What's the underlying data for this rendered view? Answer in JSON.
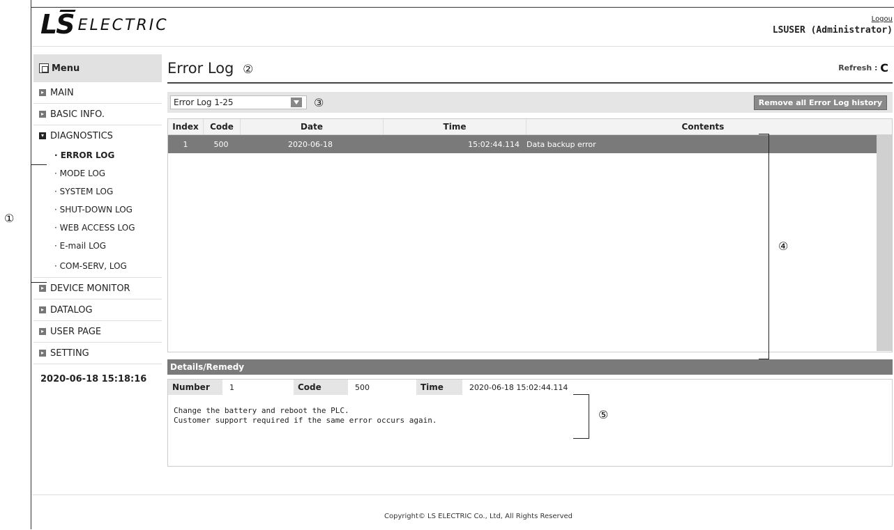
{
  "header": {
    "logo_ls": "LS",
    "logo_electric": "ELECTRIC",
    "logout": "Logou",
    "user": "LSUSER (Administrator)"
  },
  "sidebar": {
    "menu_title": "Menu",
    "items": [
      {
        "label": "MAIN"
      },
      {
        "label": "BASIC INFO."
      },
      {
        "label": "DIAGNOSTICS"
      }
    ],
    "sub_items": [
      "· ERROR LOG",
      "· MODE LOG",
      "· SYSTEM LOG",
      "· SHUT-DOWN LOG",
      "· WEB ACCESS LOG",
      "· E-mail LOG",
      "· COM-SERV, LOG"
    ],
    "items_after": [
      {
        "label": "DEVICE MONITOR"
      },
      {
        "label": "DATALOG"
      },
      {
        "label": "USER PAGE"
      },
      {
        "label": "SETTING"
      }
    ],
    "datetime": "2020-06-18 15:18:16"
  },
  "annotations": {
    "c1": "①",
    "c2": "②",
    "c3": "③",
    "c4": "④",
    "c5": "⑤"
  },
  "main": {
    "title": "Error Log",
    "refresh_label": "Refresh :",
    "refresh_icon": "C",
    "select_value": "Error Log 1-25",
    "remove_button": "Remove all Error Log history",
    "columns": [
      "Index",
      "Code",
      "Date",
      "Time",
      "Contents"
    ],
    "rows": [
      {
        "index": "1",
        "code": "500",
        "date": "2020-06-18",
        "time": "15:02:44.114",
        "contents": "Data backup error"
      }
    ],
    "details_title": "Details/Remedy",
    "details": {
      "number_label": "Number",
      "number_value": "1",
      "code_label": "Code",
      "code_value": "500",
      "time_label": "Time",
      "time_value": "2020-06-18 15:02:44.114",
      "remedy_line1": "Change the battery and reboot the PLC.",
      "remedy_line2": "Customer support required if the same error occurs again."
    }
  },
  "footer": "Copyright© LS ELECTRIC Co., Ltd, All Rights Reserved",
  "colors": {
    "selected_row": "#7a7a7a",
    "menu_bg": "#e1e1e1"
  }
}
